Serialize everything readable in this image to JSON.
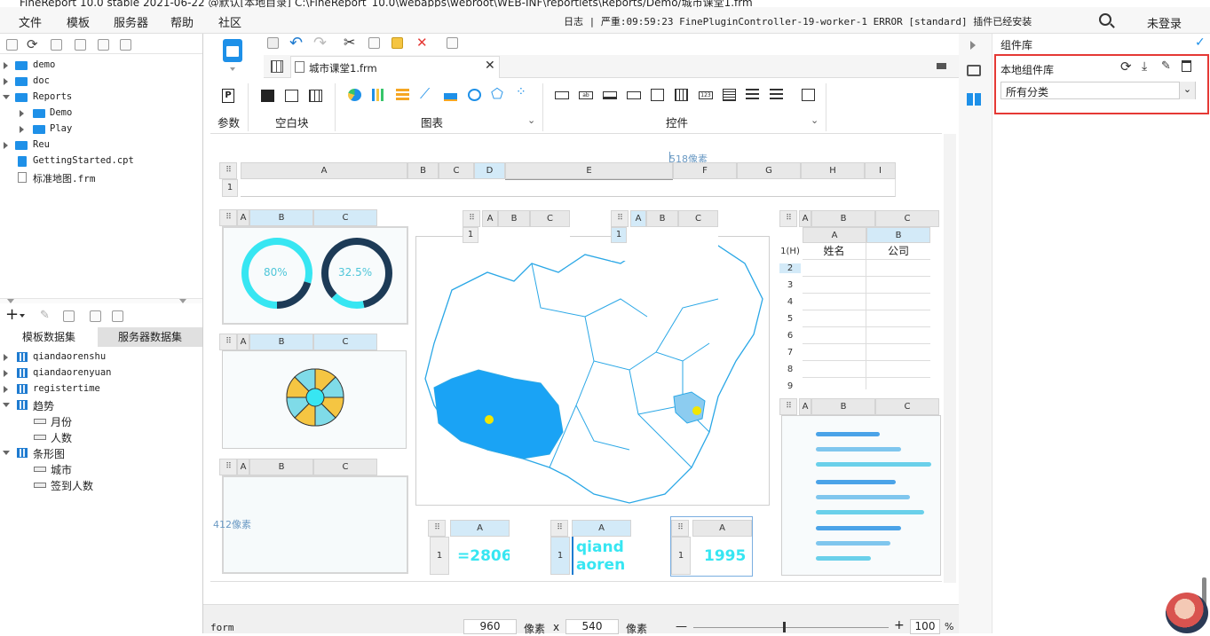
{
  "window": {
    "title_text": "FineReport 10.0 stable 2021-06-22 @默认[本地目录]",
    "title_path": "C:\\FineReport_10.0\\webapps\\webroot\\WEB-INF\\reportlets\\Reports/Demo/城市课堂1.frm"
  },
  "menubar": {
    "items": [
      "文件",
      "模板",
      "服务器",
      "帮助",
      "社区"
    ],
    "log_line": "日志 | 严重:09:59:23 FinePluginController-19-worker-1 ERROR [standard] 插件已经安装",
    "login": "未登录"
  },
  "file_tree": {
    "items": [
      {
        "label": "demo",
        "type": "folder",
        "level": 0
      },
      {
        "label": "doc",
        "type": "folder",
        "level": 0
      },
      {
        "label": "Reports",
        "type": "folder",
        "level": 0,
        "expanded": true
      },
      {
        "label": "Demo",
        "type": "folder",
        "level": 1
      },
      {
        "label": "Play",
        "type": "folder",
        "level": 1
      },
      {
        "label": "Reu",
        "type": "folder",
        "level": 0
      },
      {
        "label": "GettingStarted.cpt",
        "type": "file",
        "level": 0
      },
      {
        "label": "标准地图.frm",
        "type": "file",
        "level": 0
      }
    ]
  },
  "datasets": {
    "tabs": [
      "模板数据集",
      "服务器数据集"
    ],
    "items": [
      {
        "label": "qiandaorenshu"
      },
      {
        "label": "qiandaorenyuan"
      },
      {
        "label": "registertime"
      },
      {
        "label": "趋势",
        "fields": [
          "月份",
          "人数"
        ]
      },
      {
        "label": "条形图",
        "fields": [
          "城市",
          "签到人数"
        ]
      }
    ]
  },
  "editor": {
    "tab_title": "城市课堂1.frm",
    "ribbon": {
      "groups": [
        "参数",
        "空白块",
        "图表",
        "控件"
      ]
    },
    "canvas": {
      "width_label": "518像素",
      "height_label": "412像素",
      "top_cols": [
        "A",
        "B",
        "C",
        "D",
        "E",
        "F",
        "G",
        "H",
        "I"
      ],
      "gauge_values": [
        "80%",
        "32.5%"
      ],
      "table_headers": [
        "姓名",
        "公司"
      ],
      "table_cell": "qiandaoren",
      "row_labels": [
        "1(H)",
        "2",
        "3",
        "4",
        "5",
        "6",
        "7",
        "8",
        "9"
      ],
      "cell_values": [
        "=2806",
        "qiandaorensh",
        "1995"
      ]
    }
  },
  "statusbar": {
    "mode": "form",
    "width": "960",
    "px1": "像素",
    "times": "x",
    "height": "540",
    "px2": "像素",
    "minus": "—",
    "plus": "+",
    "zoom": "100",
    "pct": "%"
  },
  "right_panel": {
    "title": "组件库",
    "local_lib": "本地组件库",
    "category": "所有分类"
  },
  "colors": {
    "accent": "#1e90e8",
    "map_highlight": "#1aa3f5",
    "map_border": "#2aa7e6",
    "gauge_cyan": "#37e6f2",
    "gauge_navy": "#1d3b57",
    "highlight_box": "#e53935"
  }
}
